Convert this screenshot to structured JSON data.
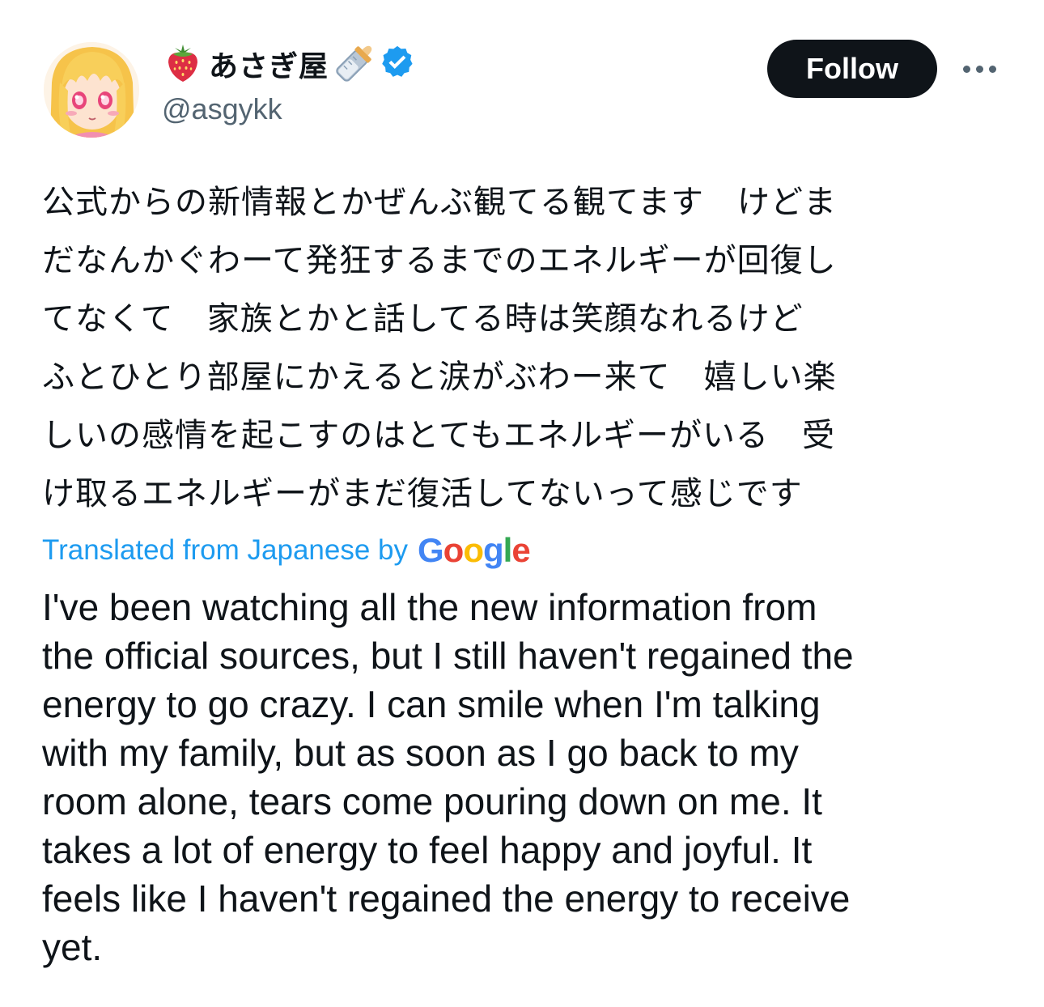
{
  "author": {
    "display_name": "あさぎ屋",
    "handle": "@asgykk",
    "name_prefix_icon": "strawberry-icon",
    "name_suffix_icon": "baby-bottle-icon",
    "verified_icon": "verified-badge-icon"
  },
  "actions": {
    "follow_label": "Follow",
    "more_icon": "more-options-icon"
  },
  "post": {
    "original_lines": [
      "公式からの新情報とかぜんぶ観てる観てます　けどま",
      "だなんかぐわーて発狂するまでのエネルギーが回復し",
      "てなくて　家族とかと話してる時は笑顔なれるけど",
      "ふとひとり部屋にかえると涙がぶわー来て　嬉しい楽",
      "しいの感情を起こすのはとてもエネルギーがいる　受",
      "け取るエネルギーがまだ復活してないって感じです"
    ],
    "translation_label": "Translated from Japanese by",
    "translation_provider": {
      "letters": [
        "G",
        "o",
        "o",
        "g",
        "l",
        "e"
      ],
      "colors": [
        "#4285F4",
        "#EA4335",
        "#FBBC05",
        "#4285F4",
        "#34A853",
        "#EA4335"
      ]
    },
    "translated_lines": [
      "I've been watching all the new information from",
      "the official sources, but I still haven't regained the",
      "energy to go crazy. I can smile when I'm talking",
      "with my family, but as soon as I go back to my",
      "room alone, tears come pouring down on me. It",
      "takes a lot of energy to feel happy and joyful. It",
      "feels like I haven't regained the energy to receive",
      "yet."
    ]
  },
  "colors": {
    "text_primary": "#0f1419",
    "text_secondary": "#536471",
    "link": "#1d9bf0",
    "verified": "#1d9bf0",
    "follow_bg": "#0f1419"
  }
}
